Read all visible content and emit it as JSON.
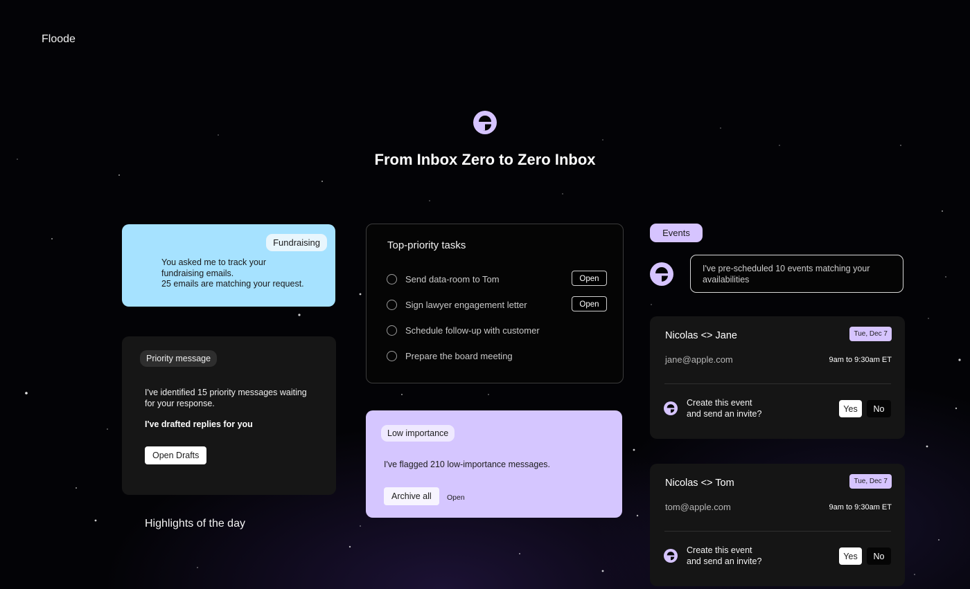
{
  "brand": {
    "name": "Floode"
  },
  "hero": {
    "title": "From Inbox Zero to Zero Inbox"
  },
  "colors": {
    "fundraising_bg": "#a6e2ff",
    "low_importance_bg": "#d5c6ff",
    "accent_lavender": "#d6c4ff",
    "card_dark": "#151515",
    "page_bg": "#030306"
  },
  "icons": {
    "brand_mark": "floode-logo-icon",
    "task_checkbox": "circle-checkbox-icon"
  },
  "fundraising": {
    "tag": "Fundraising",
    "lines": [
      "You asked me to track your",
      "fundraising emails.",
      "25 emails are matching your request."
    ]
  },
  "priority": {
    "tag": "Priority message",
    "lines": [
      "I've identified 15 priority messages waiting",
      "for your response."
    ],
    "bold_text": "I've drafted replies for you",
    "button_label": "Open Drafts"
  },
  "highlights": {
    "label": "Highlights of the day"
  },
  "tasks": {
    "title": "Top-priority tasks",
    "items": [
      {
        "label": "Send data-room to Tom",
        "action": "Open"
      },
      {
        "label": "Sign lawyer engagement letter",
        "action": "Open"
      },
      {
        "label": "Schedule follow-up with customer",
        "action": ""
      },
      {
        "label": "Prepare the board meeting",
        "action": ""
      }
    ]
  },
  "low_importance": {
    "tag": "Low importance",
    "text": "I've flagged 210 low-importance messages.",
    "archive_label": "Archive all",
    "open_label": "Open"
  },
  "events": {
    "tag": "Events",
    "assistant_message_lines": [
      "I've pre-scheduled 10 events matching your",
      "availabilities"
    ],
    "cards": [
      {
        "title": "Nicolas <> Jane",
        "date": "Tue, Dec 7",
        "email": "jane@apple.com",
        "time": "9am to 9:30am ET",
        "question_lines": [
          "Create this event",
          "and send an invite?"
        ],
        "yes_label": "Yes",
        "no_label": "No"
      },
      {
        "title": "Nicolas <> Tom",
        "date": "Tue, Dec 7",
        "email": "tom@apple.com",
        "time": "9am to 9:30am ET",
        "question_lines": [
          "Create this event",
          "and send an invite?"
        ],
        "yes_label": "Yes",
        "no_label": "No"
      }
    ]
  }
}
